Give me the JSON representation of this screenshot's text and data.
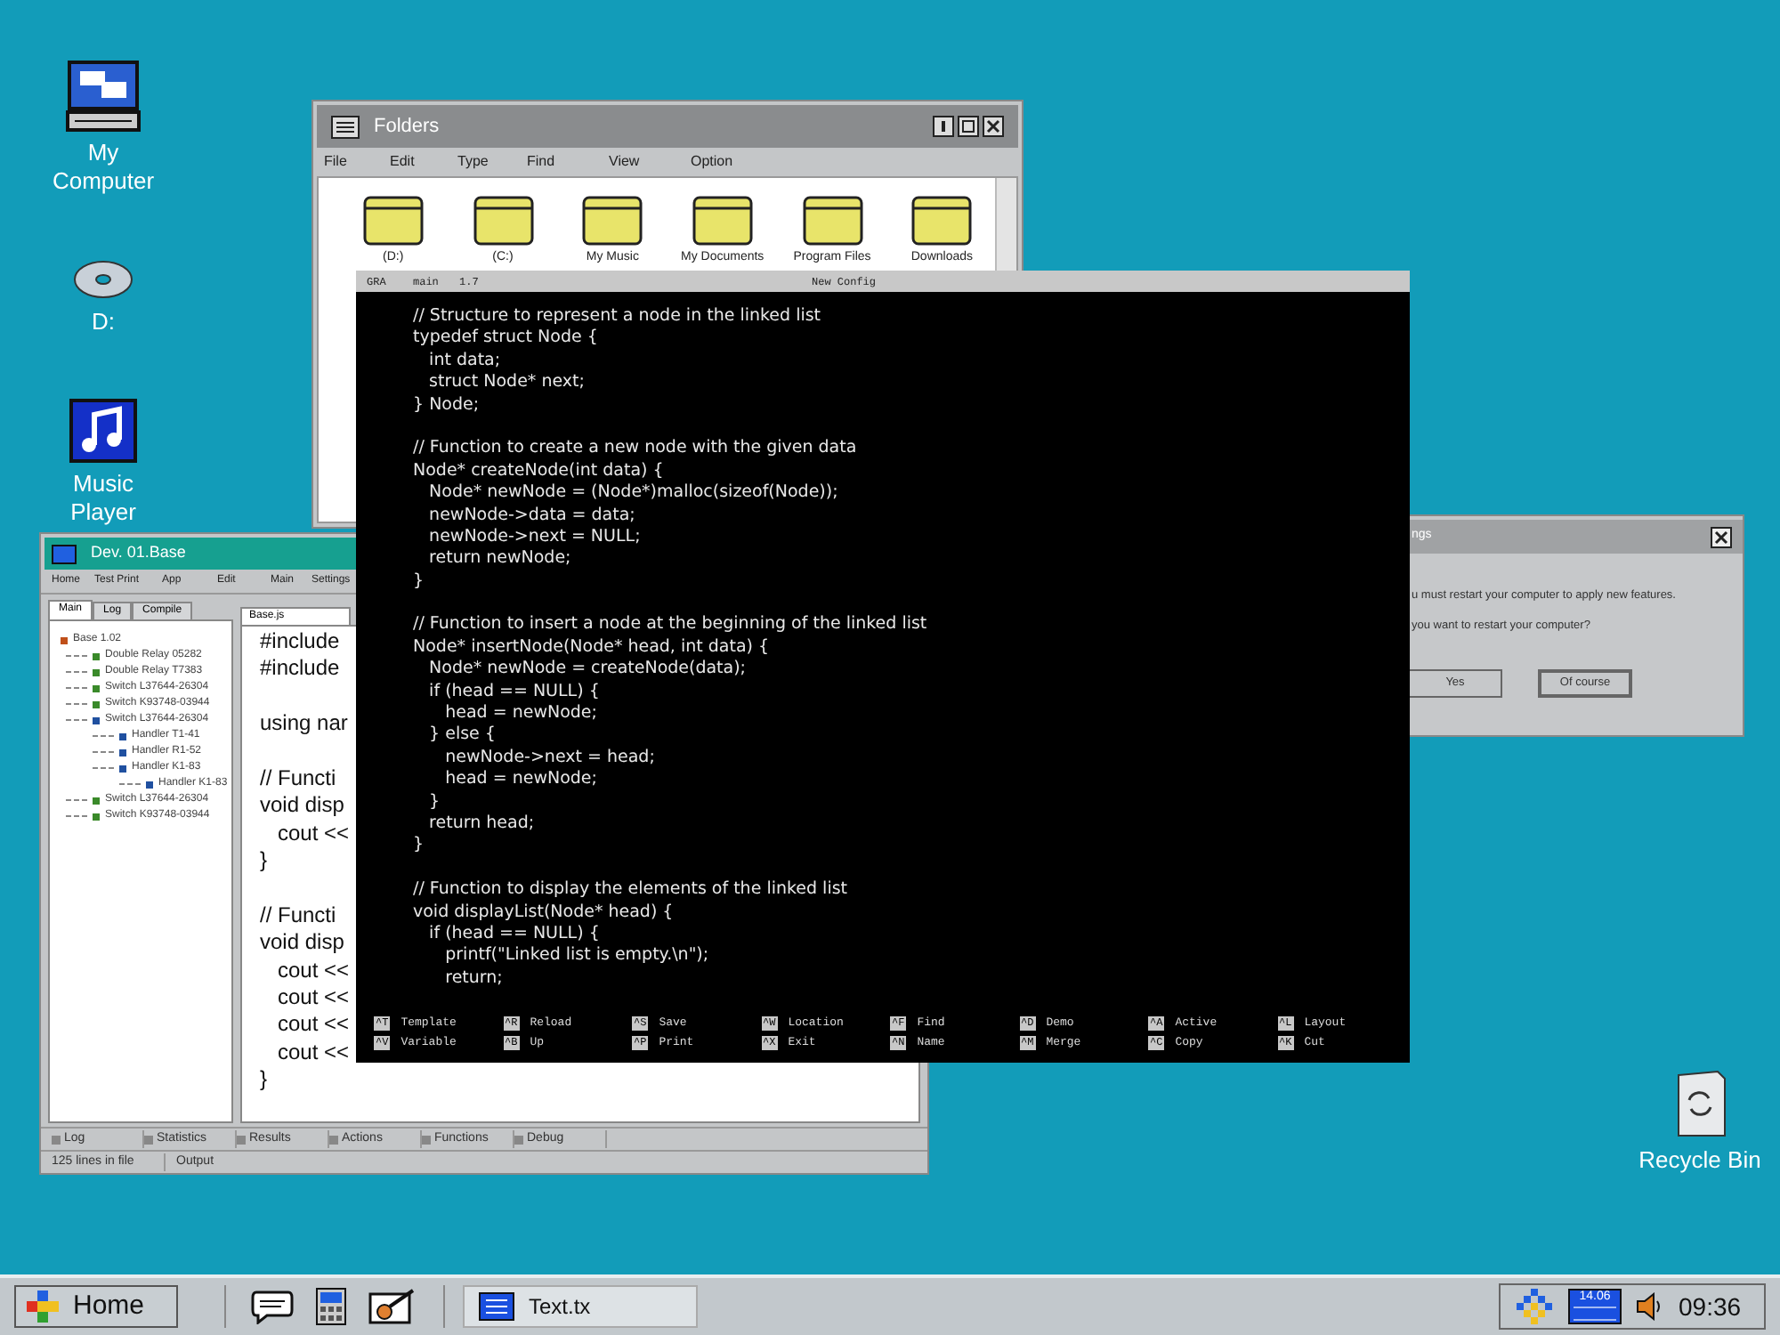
{
  "desktop_icons": [
    {
      "kind": "computer",
      "label": "My Computer"
    },
    {
      "kind": "disc",
      "label": "D:"
    },
    {
      "kind": "music",
      "label": "Music Player"
    },
    {
      "kind": "recycle",
      "label": "Recycle Bin"
    }
  ],
  "folders_window": {
    "title": "Folders",
    "menu": [
      "File",
      "Edit",
      "Type",
      "Find",
      "View",
      "Option"
    ],
    "items": [
      "(D:)",
      "(C:)",
      "My Music",
      "My Documents",
      "Program Files",
      "Downloads"
    ]
  },
  "dev_window": {
    "title": "Dev. 01.Base",
    "menu": [
      "Home",
      "Test Print",
      "App",
      "Edit",
      "Main",
      "Settings"
    ],
    "panel_tabs": [
      {
        "label": "Main",
        "selected": true
      },
      {
        "label": "Log",
        "selected": false
      },
      {
        "label": "Compile",
        "selected": false
      }
    ],
    "tree": [
      {
        "label": "Base 1.02",
        "color": "#c0501a",
        "children": [
          {
            "label": "Double Relay 05282",
            "color": "#3a8a2a"
          },
          {
            "label": "Double Relay T7383",
            "color": "#3a8a2a"
          },
          {
            "label": "Switch L37644-26304",
            "color": "#3a8a2a"
          },
          {
            "label": "Switch K93748-03944",
            "color": "#3a8a2a"
          },
          {
            "label": "Switch L37644-26304",
            "color": "#2050a0",
            "children": [
              {
                "label": "Handler T1-41",
                "color": "#2050a0"
              },
              {
                "label": "Handler R1-52",
                "color": "#2050a0"
              },
              {
                "label": "Handler K1-83",
                "color": "#2050a0",
                "children": [
                  {
                    "label": "Handler K1-83",
                    "color": "#2050a0"
                  }
                ]
              }
            ]
          },
          {
            "label": "Switch L37644-26304",
            "color": "#3a8a2a"
          },
          {
            "label": "Switch K93748-03944",
            "color": "#3a8a2a"
          }
        ]
      }
    ],
    "editor_tab": "Base.js",
    "code_blocks": [
      [
        "#include",
        "#include"
      ],
      [
        "using nar"
      ],
      [
        "// Functi",
        "void disp",
        "   cout <<",
        "}"
      ],
      [
        "// Functi",
        "void disp",
        "   cout <<",
        "   cout <<",
        "   cout <<",
        "   cout <<",
        "}"
      ]
    ],
    "bottom_tabs": [
      "Log",
      "Statistics",
      "Results",
      "Actions",
      "Functions",
      "Debug"
    ],
    "status": [
      "125 lines in file",
      "Output"
    ]
  },
  "editor": {
    "header": [
      "GRA",
      "main",
      "1.7"
    ],
    "title": "New Config",
    "code_blocks": [
      [
        "// Structure to represent a node in the linked list",
        "typedef struct Node {",
        "   int data;",
        "   struct Node* next;",
        "} Node;"
      ],
      [
        "// Function to create a new node with the given data",
        "Node* createNode(int data) {",
        "   Node* newNode = (Node*)malloc(sizeof(Node));",
        "   newNode->data = data;",
        "   newNode->next = NULL;",
        "   return newNode;",
        "}"
      ],
      [
        "// Function to insert a node at the beginning of the linked list",
        "Node* insertNode(Node* head, int data) {",
        "   Node* newNode = createNode(data);",
        "   if (head == NULL) {",
        "      head = newNode;",
        "   } else {",
        "      newNode->next = head;",
        "      head = newNode;",
        "   }",
        "   return head;",
        "}"
      ],
      [
        "// Function to display the elements of the linked list",
        "void displayList(Node* head) {",
        "   if (head == NULL) {",
        "      printf(\"Linked list is empty.\\n\");",
        "      return;"
      ]
    ],
    "shortcuts": [
      [
        {
          "key": "^T",
          "label": "Template"
        },
        {
          "key": "^V",
          "label": "Variable"
        }
      ],
      [
        {
          "key": "^R",
          "label": "Reload"
        },
        {
          "key": "^B",
          "label": "Up"
        }
      ],
      [
        {
          "key": "^S",
          "label": "Save"
        },
        {
          "key": "^P",
          "label": "Print"
        }
      ],
      [
        {
          "key": "^W",
          "label": "Location"
        },
        {
          "key": "^X",
          "label": "Exit"
        }
      ],
      [
        {
          "key": "^F",
          "label": "Find"
        },
        {
          "key": "^N",
          "label": "Name"
        }
      ],
      [
        {
          "key": "^D",
          "label": "Demo"
        },
        {
          "key": "^M",
          "label": "Merge"
        }
      ],
      [
        {
          "key": "^A",
          "label": "Active"
        },
        {
          "key": "^C",
          "label": "Copy"
        }
      ],
      [
        {
          "key": "^L",
          "label": "Layout"
        },
        {
          "key": "^K",
          "label": "Cut"
        }
      ]
    ]
  },
  "dialog": {
    "title": "ngs",
    "lines": [
      "u must restart your computer to apply new features.",
      "you want to restart your computer?"
    ],
    "buttons": [
      "Yes",
      "Of course"
    ]
  },
  "taskbar": {
    "start": "Home",
    "task": "Text.tx",
    "calendar": "14.06",
    "clock": "09:36"
  }
}
